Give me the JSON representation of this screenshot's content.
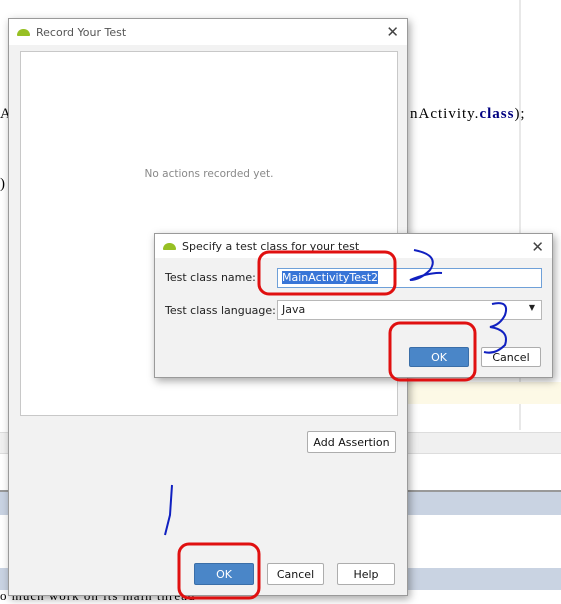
{
  "background_code": {
    "line1_left": "Ac",
    "line1_right_prefix": "nActivity.",
    "line1_keyword": "class",
    "line1_suffix": ");",
    "line2_left": ")",
    "status_text": "o much work on its main thread"
  },
  "record_dialog": {
    "title": "Record Your Test",
    "empty_message": "No actions recorded yet.",
    "add_assertion_label": "Add Assertion",
    "ok_label": "OK",
    "cancel_label": "Cancel",
    "help_label": "Help"
  },
  "class_dialog": {
    "title": "Specify a test class for your test",
    "class_name_label": "Test class name:",
    "class_name_value": "MainActivityTest2",
    "language_label": "Test class language:",
    "language_value": "Java",
    "ok_label": "OK",
    "cancel_label": "Cancel"
  },
  "colors": {
    "primary_button": "#4a86c8",
    "annotation_red": "#e01010",
    "annotation_blue": "#1020c0",
    "android": "#97c024"
  },
  "icons": [
    "android-icon",
    "close-icon",
    "dropdown-arrow-icon"
  ]
}
